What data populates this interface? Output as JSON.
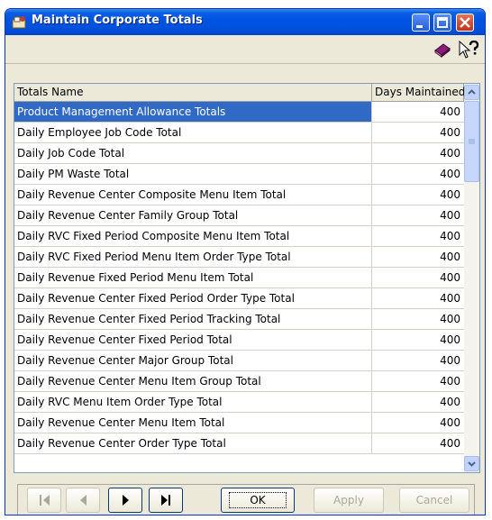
{
  "window": {
    "title": "Maintain Corporate Totals"
  },
  "toolbar": {
    "icons": [
      "book-icon",
      "help-pointer-icon"
    ]
  },
  "grid": {
    "columns": [
      "Totals Name",
      "Days Maintained"
    ],
    "rows": [
      {
        "name": "Product Management Allowance Totals",
        "days": "400",
        "selected": true
      },
      {
        "name": "Daily Employee Job Code Total",
        "days": "400"
      },
      {
        "name": "Daily Job Code Total",
        "days": "400"
      },
      {
        "name": "Daily PM Waste Total",
        "days": "400"
      },
      {
        "name": "Daily Revenue Center Composite Menu Item Total",
        "days": "400"
      },
      {
        "name": "Daily Revenue Center Family Group Total",
        "days": "400"
      },
      {
        "name": "Daily RVC Fixed Period Composite Menu Item Total",
        "days": "400"
      },
      {
        "name": "Daily RVC Fixed Period Menu Item Order Type Total",
        "days": "400"
      },
      {
        "name": "Daily Revenue Fixed Period Menu Item Total",
        "days": "400"
      },
      {
        "name": "Daily Revenue Center Fixed Period Order Type Total",
        "days": "400"
      },
      {
        "name": "Daily Revenue Center Fixed Period Tracking Total",
        "days": "400"
      },
      {
        "name": "Daily Revenue Center Fixed Period Total",
        "days": "400"
      },
      {
        "name": "Daily Revenue Center Major Group Total",
        "days": "400"
      },
      {
        "name": "Daily Revenue Center Menu Item Group Total",
        "days": "400"
      },
      {
        "name": "Daily RVC Menu Item Order Type Total",
        "days": "400"
      },
      {
        "name": "Daily Revenue Center Menu Item Total",
        "days": "400"
      },
      {
        "name": "Daily Revenue Center Order Type Total",
        "days": "400"
      }
    ]
  },
  "buttons": {
    "ok": "OK",
    "apply": "Apply",
    "cancel": "Cancel"
  },
  "colors": {
    "title_bar": "#0054e3",
    "selection": "#316ac5",
    "face": "#ece9d8"
  }
}
